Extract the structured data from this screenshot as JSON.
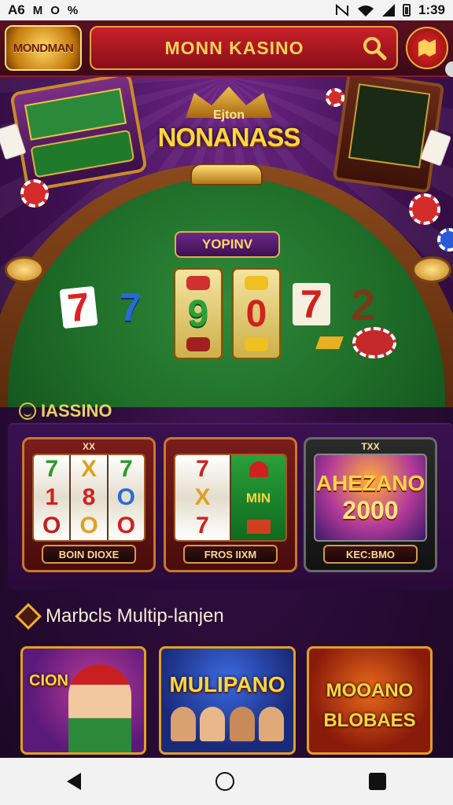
{
  "status_bar": {
    "left": [
      "A6",
      "M",
      "O",
      "%"
    ],
    "time": "1:39"
  },
  "header": {
    "logo_text": "MONDMAN",
    "search_label": "MONN KASINO",
    "search_icon": "search-icon",
    "profile_icon": "map-icon"
  },
  "hero": {
    "badge_small": "Ejton",
    "badge_title": "NONANASS",
    "game_label": "YOPINV",
    "reel_digits": [
      "9",
      "0"
    ],
    "symbols": [
      "7",
      "7",
      "7",
      "2"
    ]
  },
  "section1": {
    "title": "IASSINO"
  },
  "slot_cards": [
    {
      "top": "XX",
      "button": "BOIN DIOXE",
      "reels": [
        [
          "7",
          "1",
          "O"
        ],
        [
          "X",
          "8",
          "O"
        ],
        [
          "7",
          "O",
          "O"
        ]
      ]
    },
    {
      "top": "",
      "button": "FROS IIXM",
      "reels": [
        [
          "7",
          "X",
          "7"
        ],
        [
          "MIN",
          "",
          ""
        ]
      ]
    },
    {
      "top": "TXX",
      "button": "KEC:BMO",
      "promo_a": "AHEZANO",
      "promo_b": "2000"
    }
  ],
  "section2": {
    "title": "Marbcls Multip-lanjen"
  },
  "tiles": [
    {
      "name": "CION"
    },
    {
      "name": "MULIPANO"
    },
    {
      "name_a": "MOOANO",
      "name_b": "BLOBAES"
    }
  ],
  "colors": {
    "accent_gold": "#ffd640",
    "header_red": "#8a0f18",
    "felt_green": "#1d6a27"
  }
}
